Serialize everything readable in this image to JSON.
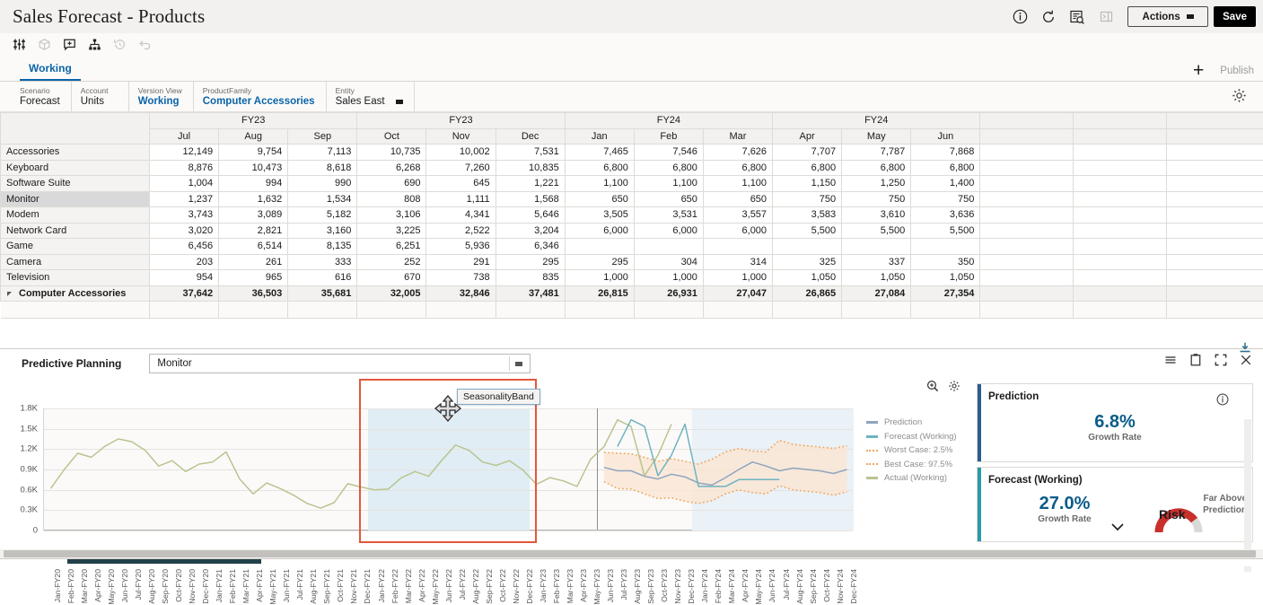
{
  "header": {
    "title": "Sales Forecast - Products",
    "right_icons": [
      {
        "name": "info-icon",
        "glyph": "info"
      },
      {
        "name": "refresh-icon",
        "glyph": "refresh"
      },
      {
        "name": "inspect-data-icon",
        "glyph": "inspect"
      },
      {
        "name": "panel-toggle-icon",
        "glyph": "panel"
      }
    ],
    "actions_label": "Actions",
    "save_label": "Save"
  },
  "toolbar": {
    "icons": [
      {
        "name": "adjust-sliders-icon"
      },
      {
        "name": "cube-icon"
      },
      {
        "name": "comment-add-icon"
      },
      {
        "name": "hierarchy-icon"
      },
      {
        "name": "history-icon"
      },
      {
        "name": "undo-icon"
      }
    ]
  },
  "tabs": {
    "active": "Working",
    "plus_label": "+",
    "publish_label": "Publish"
  },
  "pov": [
    {
      "label": "Scenario",
      "value": "Forecast",
      "blue": false
    },
    {
      "label": "Account",
      "value": "Units",
      "blue": false
    },
    {
      "label": "Version View",
      "value": "Working",
      "blue": true
    },
    {
      "label": "ProductFamily",
      "value": "Computer Accessories",
      "blue": true
    },
    {
      "label": "Entity",
      "value": "Sales East",
      "blue": false
    }
  ],
  "grid": {
    "year_groups": [
      {
        "label": "FY23",
        "span": 3
      },
      {
        "label": "FY23",
        "span": 3
      },
      {
        "label": "FY24",
        "span": 3
      },
      {
        "label": "FY24",
        "span": 3
      }
    ],
    "months": [
      "Jul",
      "Aug",
      "Sep",
      "Oct",
      "Nov",
      "Dec",
      "Jan",
      "Feb",
      "Mar",
      "Apr",
      "May",
      "Jun"
    ],
    "rows": [
      {
        "label": "Accessories",
        "selected": false,
        "total": false,
        "values": [
          "12,149",
          "9,754",
          "7,113",
          "10,735",
          "10,002",
          "7,531",
          "7,465",
          "7,546",
          "7,626",
          "7,707",
          "7,787",
          "7,868"
        ]
      },
      {
        "label": "Keyboard",
        "selected": false,
        "total": false,
        "values": [
          "8,876",
          "10,473",
          "8,618",
          "6,268",
          "7,260",
          "10,835",
          "6,800",
          "6,800",
          "6,800",
          "6,800",
          "6,800",
          "6,800"
        ]
      },
      {
        "label": "Software Suite",
        "selected": false,
        "total": false,
        "values": [
          "1,004",
          "994",
          "990",
          "690",
          "645",
          "1,221",
          "1,100",
          "1,100",
          "1,100",
          "1,150",
          "1,250",
          "1,400"
        ]
      },
      {
        "label": "Monitor",
        "selected": true,
        "total": false,
        "values": [
          "1,237",
          "1,632",
          "1,534",
          "808",
          "1,111",
          "1,568",
          "650",
          "650",
          "650",
          "750",
          "750",
          "750"
        ]
      },
      {
        "label": "Modem",
        "selected": false,
        "total": false,
        "values": [
          "3,743",
          "3,089",
          "5,182",
          "3,106",
          "4,341",
          "5,646",
          "3,505",
          "3,531",
          "3,557",
          "3,583",
          "3,610",
          "3,636"
        ]
      },
      {
        "label": "Network Card",
        "selected": false,
        "total": false,
        "values": [
          "3,020",
          "2,821",
          "3,160",
          "3,225",
          "2,522",
          "3,204",
          "6,000",
          "6,000",
          "6,000",
          "5,500",
          "5,500",
          "5,500"
        ]
      },
      {
        "label": "Game",
        "selected": false,
        "total": false,
        "values": [
          "6,456",
          "6,514",
          "8,135",
          "6,251",
          "5,936",
          "6,346",
          "",
          "",
          "",
          "",
          "",
          ""
        ]
      },
      {
        "label": "Camera",
        "selected": false,
        "total": false,
        "values": [
          "203",
          "261",
          "333",
          "252",
          "291",
          "295",
          "295",
          "304",
          "314",
          "325",
          "337",
          "350"
        ]
      },
      {
        "label": "Television",
        "selected": false,
        "total": false,
        "values": [
          "954",
          "965",
          "616",
          "670",
          "738",
          "835",
          "1,000",
          "1,000",
          "1,000",
          "1,050",
          "1,050",
          "1,050"
        ]
      },
      {
        "label": "Computer Accessories",
        "selected": false,
        "total": true,
        "values": [
          "37,642",
          "36,503",
          "35,681",
          "32,005",
          "32,846",
          "37,481",
          "26,815",
          "26,931",
          "27,047",
          "26,865",
          "27,084",
          "27,354"
        ]
      }
    ]
  },
  "predictive": {
    "panel_title": "Predictive Planning",
    "member_value": "Monitor",
    "head_icons": [
      {
        "name": "list-menu-icon"
      },
      {
        "name": "copy-icon"
      },
      {
        "name": "maximize-icon"
      },
      {
        "name": "close-icon"
      },
      {
        "name": "dock-bottom-icon"
      }
    ],
    "chart_tools": [
      {
        "name": "zoom-in-icon"
      },
      {
        "name": "chart-settings-icon"
      }
    ],
    "tooltip_text": "SeasonalityBand",
    "cards": [
      {
        "title": "Prediction",
        "pct": "6.8%",
        "sub": "Growth Rate",
        "accent": "#2d5d8e",
        "info_icon": "info-icon"
      },
      {
        "title": "Forecast (Working)",
        "pct": "27.0%",
        "sub": "Growth Rate",
        "accent": "#2a9aa8",
        "risk_label": "Risk",
        "risk_note_line1": "Far Above",
        "risk_note_line2": "Prediction",
        "risk_color": "#c9302c"
      }
    ]
  },
  "chart_data": {
    "type": "line",
    "title": "",
    "xlabel": "",
    "ylabel": "",
    "ylim": [
      0,
      1800
    ],
    "ytick_labels": [
      "1.8K",
      "1.5K",
      "1.2K",
      "0.9K",
      "0.6K",
      "0.3K",
      "0"
    ],
    "ytick_values": [
      1800,
      1500,
      1200,
      900,
      600,
      300,
      0
    ],
    "grid": true,
    "legend_position": "right",
    "legend": [
      {
        "name": "Prediction",
        "color": "#8fa5bd",
        "style": "solid"
      },
      {
        "name": "Forecast (Working)",
        "color": "#6fb3c0",
        "style": "solid"
      },
      {
        "name": "Worst Case: 2.5%",
        "color": "#f0a860",
        "style": "dotted"
      },
      {
        "name": "Best Case: 97.5%",
        "color": "#f0a860",
        "style": "dotted"
      },
      {
        "name": "Actual (Working)",
        "color": "#b9c48f",
        "style": "solid"
      }
    ],
    "x": [
      "Jan-FY20",
      "Feb-FY20",
      "Mar-FY20",
      "Apr-FY20",
      "May-FY20",
      "Jun-FY20",
      "Jul-FY20",
      "Aug-FY20",
      "Sep-FY20",
      "Oct-FY20",
      "Nov-FY20",
      "Dec-FY20",
      "Jan-FY21",
      "Feb-FY21",
      "Mar-FY21",
      "Apr-FY21",
      "May-FY21",
      "Jun-FY21",
      "Jul-FY21",
      "Aug-FY21",
      "Sep-FY21",
      "Oct-FY21",
      "Nov-FY21",
      "Dec-FY21",
      "Jan-FY22",
      "Feb-FY22",
      "Mar-FY22",
      "Apr-FY22",
      "May-FY22",
      "Jun-FY22",
      "Jul-FY22",
      "Aug-FY22",
      "Sep-FY22",
      "Oct-FY22",
      "Nov-FY22",
      "Dec-FY22",
      "Jan-FY23",
      "Feb-FY23",
      "Mar-FY23",
      "Apr-FY23",
      "May-FY23",
      "Jun-FY23",
      "Jul-FY23",
      "Aug-FY23",
      "Sep-FY23",
      "Oct-FY23",
      "Nov-FY23",
      "Dec-FY23",
      "Jan-FY24",
      "Feb-FY24",
      "Mar-FY24",
      "Apr-FY24",
      "May-FY24",
      "Jun-FY24",
      "Jul-FY24",
      "Aug-FY24",
      "Sep-FY24",
      "Oct-FY24",
      "Nov-FY24",
      "Dec-FY24"
    ],
    "series": [
      {
        "name": "Actual (Working)",
        "color": "#b9c48f",
        "style": "solid",
        "values": [
          620,
          900,
          1140,
          1080,
          1240,
          1350,
          1310,
          1180,
          950,
          1030,
          870,
          980,
          1010,
          1160,
          760,
          540,
          700,
          620,
          520,
          400,
          330,
          410,
          690,
          640,
          600,
          610,
          780,
          870,
          800,
          1040,
          1260,
          1180,
          1010,
          960,
          1030,
          890,
          680,
          780,
          730,
          650,
          1050,
          1237,
          1632,
          1534,
          808,
          1111,
          1568,
          null,
          null,
          null,
          null,
          null,
          null,
          null,
          null,
          null,
          null,
          null,
          null,
          null
        ]
      },
      {
        "name": "Forecast (Working)",
        "color": "#6fb3c0",
        "style": "solid",
        "values": [
          null,
          null,
          null,
          null,
          null,
          null,
          null,
          null,
          null,
          null,
          null,
          null,
          null,
          null,
          null,
          null,
          null,
          null,
          null,
          null,
          null,
          null,
          null,
          null,
          null,
          null,
          null,
          null,
          null,
          null,
          null,
          null,
          null,
          null,
          null,
          null,
          null,
          null,
          null,
          null,
          null,
          null,
          1237,
          1632,
          1534,
          808,
          1111,
          1568,
          650,
          650,
          650,
          750,
          750,
          750,
          750,
          null,
          null,
          null,
          null,
          null
        ]
      },
      {
        "name": "Prediction",
        "color": "#8fa5bd",
        "style": "solid",
        "values": [
          null,
          null,
          null,
          null,
          null,
          null,
          null,
          null,
          null,
          null,
          null,
          null,
          null,
          null,
          null,
          null,
          null,
          null,
          null,
          null,
          null,
          null,
          null,
          null,
          null,
          null,
          null,
          null,
          null,
          null,
          null,
          null,
          null,
          null,
          null,
          null,
          null,
          null,
          null,
          null,
          null,
          930,
          880,
          880,
          800,
          760,
          830,
          790,
          700,
          670,
          780,
          900,
          1010,
          950,
          880,
          920,
          900,
          880,
          840,
          900
        ]
      },
      {
        "name": "Best Case: 97.5%",
        "color": "#f0a860",
        "style": "dotted",
        "values": [
          null,
          null,
          null,
          null,
          null,
          null,
          null,
          null,
          null,
          null,
          null,
          null,
          null,
          null,
          null,
          null,
          null,
          null,
          null,
          null,
          null,
          null,
          null,
          null,
          null,
          null,
          null,
          null,
          null,
          null,
          null,
          null,
          null,
          null,
          null,
          null,
          null,
          null,
          null,
          null,
          null,
          1150,
          1140,
          1130,
          1080,
          1020,
          1060,
          1020,
          980,
          1050,
          1160,
          1210,
          1170,
          1160,
          1330,
          1270,
          1250,
          1230,
          1210,
          1250
        ]
      },
      {
        "name": "Worst Case: 2.5%",
        "color": "#f0a860",
        "style": "dotted",
        "values": [
          null,
          null,
          null,
          null,
          null,
          null,
          null,
          null,
          null,
          null,
          null,
          null,
          null,
          null,
          null,
          null,
          null,
          null,
          null,
          null,
          null,
          null,
          null,
          null,
          null,
          null,
          null,
          null,
          null,
          null,
          null,
          null,
          null,
          null,
          null,
          null,
          null,
          null,
          null,
          null,
          null,
          720,
          620,
          610,
          540,
          470,
          480,
          430,
          400,
          440,
          540,
          600,
          560,
          540,
          660,
          600,
          580,
          560,
          520,
          570
        ]
      }
    ],
    "bands": [
      {
        "name": "SeasonalityBand",
        "from": "Jan-FY22",
        "to": "Dec-FY22",
        "color": "#daeaf4"
      },
      {
        "name": "ForecastBand",
        "from": "Jan-FY24",
        "to": "Dec-FY24",
        "color": "#eaf1f7"
      }
    ]
  }
}
